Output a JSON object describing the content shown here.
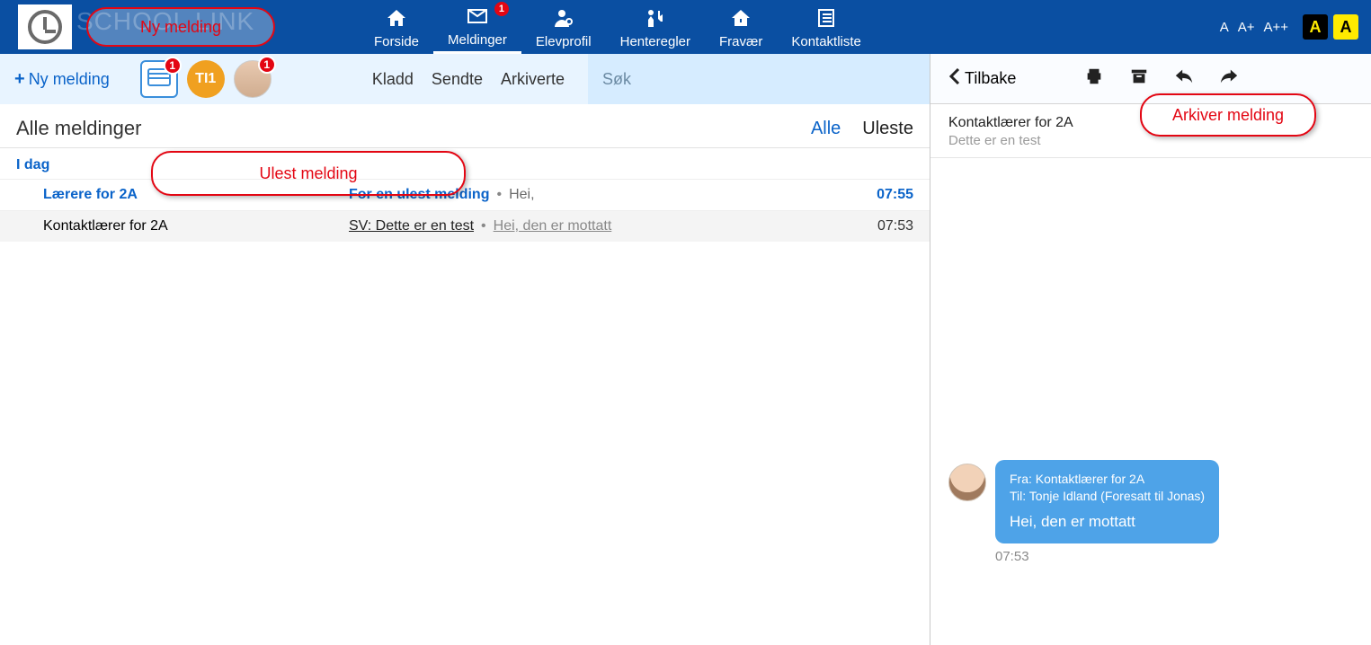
{
  "brand": "SCHOOL LINK",
  "nav": {
    "forside": "Forside",
    "meldinger": "Meldinger",
    "meldinger_badge": "1",
    "elevprofil": "Elevprofil",
    "henteregler": "Henteregler",
    "fravaer": "Fravær",
    "kontaktliste": "Kontaktliste"
  },
  "fontsizer": {
    "a": "A",
    "ap": "A+",
    "app": "A++"
  },
  "contrast": {
    "black": "A",
    "yellow": "A"
  },
  "leftbar": {
    "new_message": "Ny melding",
    "inbox_badge": "1",
    "avatar1_label": "TI",
    "avatar1_badge": "1",
    "avatar2_badge": "1",
    "tabs": {
      "kladd": "Kladd",
      "sendte": "Sendte",
      "arkiverte": "Arkiverte"
    },
    "search_placeholder": "Søk"
  },
  "list": {
    "title": "Alle meldinger",
    "filters": {
      "alle": "Alle",
      "uleste": "Uleste"
    },
    "section_today": "I dag",
    "rows": [
      {
        "sender": "Lærere for 2A",
        "subject": "For en ulest melding",
        "preview": "Hei,",
        "time": "07:55"
      },
      {
        "sender": "Kontaktlærer for 2A",
        "subject": "SV: Dette er en test",
        "preview": "Hei, den er mottatt",
        "time": "07:53"
      }
    ]
  },
  "detail": {
    "back": "Tilbake",
    "sender": "Kontaktlærer for 2A",
    "preview": "Dette er en test",
    "bubble": {
      "from": "Fra: Kontaktlærer for 2A",
      "to": "Til: Tonje Idland (Foresatt til Jonas)",
      "body": "Hei, den er mottatt",
      "time": "07:53"
    }
  },
  "annotations": {
    "ny_melding": "Ny melding",
    "ulest_melding": "Ulest melding",
    "arkiver_melding": "Arkiver melding"
  }
}
